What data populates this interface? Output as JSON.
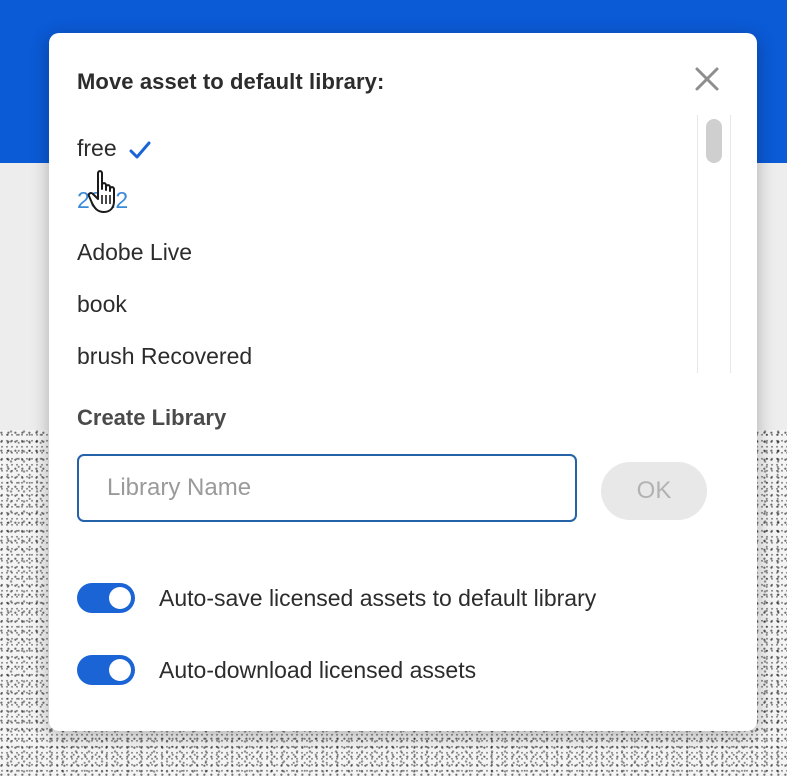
{
  "dialog": {
    "title": "Move asset to default library:",
    "close_icon": "close-icon"
  },
  "libraries": {
    "items": [
      {
        "label": "free",
        "selected": true
      },
      {
        "label": "2022",
        "selected": false
      },
      {
        "label": "Adobe Live",
        "selected": false
      },
      {
        "label": "book",
        "selected": false
      },
      {
        "label": "brush Recovered",
        "selected": false
      }
    ],
    "selected_icon": "checkmark-icon"
  },
  "create_library": {
    "heading": "Create Library",
    "input_value": "",
    "input_placeholder": "Library Name",
    "ok_label": "OK"
  },
  "settings": {
    "auto_save": {
      "label": "Auto-save licensed assets to default library",
      "enabled": true
    },
    "auto_download": {
      "label": "Auto-download licensed assets",
      "enabled": true
    }
  },
  "colors": {
    "header_blue": "#0b5ad6",
    "accent": "#1a64d6",
    "checkmark": "#1a64d6",
    "link_hover": "#3b8ad8",
    "input_border": "#2563a8"
  }
}
